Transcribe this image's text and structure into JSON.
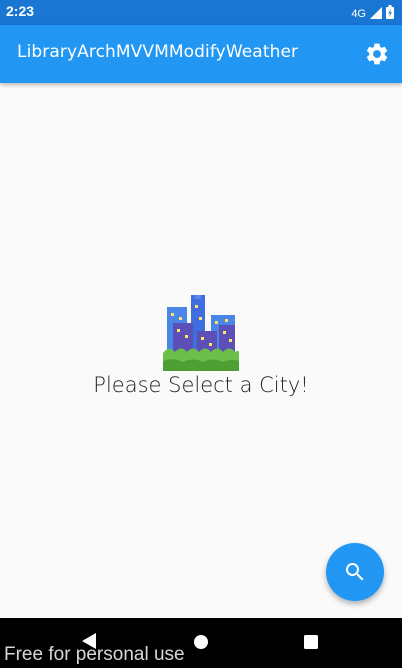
{
  "status_bar": {
    "time": "2:23",
    "network": "4G",
    "icons": [
      "signal-icon",
      "battery-icon"
    ]
  },
  "app_bar": {
    "title": "LibraryArchMVVMModifyWeather",
    "settings_icon": "gear-icon",
    "background": "#2196f3"
  },
  "content": {
    "illustration": "cityscape-icon",
    "message": "Please Select a City!"
  },
  "fab": {
    "icon": "search-icon",
    "color": "#2196f3"
  },
  "nav_bar": {
    "icons": [
      "back-icon",
      "home-icon",
      "recents-icon"
    ]
  },
  "watermark": {
    "text": "Free for personal use"
  }
}
